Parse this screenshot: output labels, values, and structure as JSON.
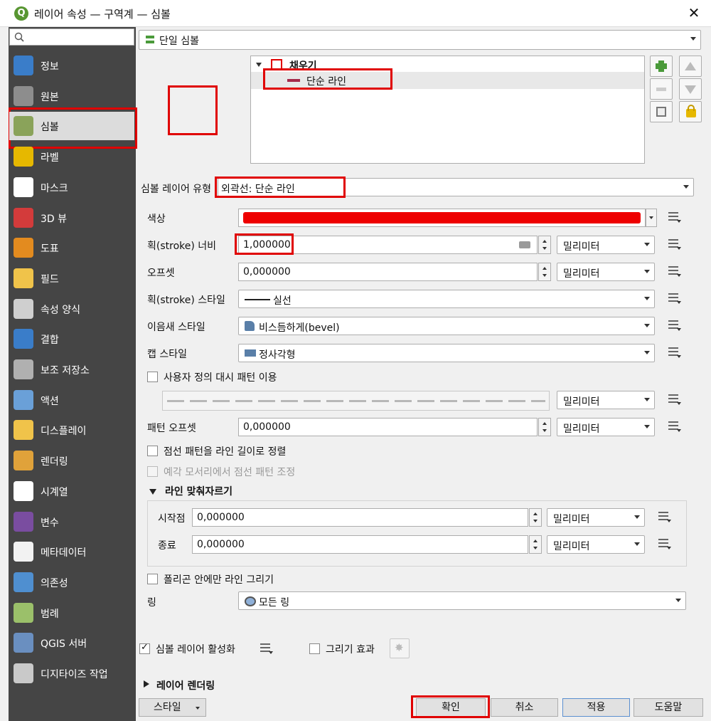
{
  "window": {
    "title": "레이어 속성 — 구역계 — 심볼",
    "app_icon": "Q",
    "close_label": "✕"
  },
  "sidebar": {
    "items": [
      {
        "label": "정보",
        "icon": "info-icon",
        "color": "#3a7dc9"
      },
      {
        "label": "원본",
        "icon": "source-icon",
        "color": "#8d8d8d"
      },
      {
        "label": "심볼",
        "icon": "symbology-icon",
        "color": "#8aa35a"
      },
      {
        "label": "라벨",
        "icon": "labels-icon",
        "color": "#e6b800"
      },
      {
        "label": "마스크",
        "icon": "mask-icon",
        "color": "#ffffff"
      },
      {
        "label": "3D 뷰",
        "icon": "3d-view-icon",
        "color": "#d33b3b"
      },
      {
        "label": "도표",
        "icon": "diagram-icon",
        "color": "#e38b1f"
      },
      {
        "label": "필드",
        "icon": "fields-icon",
        "color": "#f0c34a"
      },
      {
        "label": "속성 양식",
        "icon": "attributes-form-icon",
        "color": "#cfcfcf"
      },
      {
        "label": "결합",
        "icon": "joins-icon",
        "color": "#3a7dc9"
      },
      {
        "label": "보조 저장소",
        "icon": "auxiliary-storage-icon",
        "color": "#b0b0b0"
      },
      {
        "label": "액션",
        "icon": "actions-icon",
        "color": "#6aa0d8"
      },
      {
        "label": "디스플레이",
        "icon": "display-icon",
        "color": "#f0c34a"
      },
      {
        "label": "렌더링",
        "icon": "rendering-icon",
        "color": "#e0a23a"
      },
      {
        "label": "시계열",
        "icon": "temporal-icon",
        "color": "#ffffff"
      },
      {
        "label": "변수",
        "icon": "variables-icon",
        "color": "#7a4da0"
      },
      {
        "label": "메타데이터",
        "icon": "metadata-icon",
        "color": "#f2f2f2"
      },
      {
        "label": "의존성",
        "icon": "dependencies-icon",
        "color": "#4f8fd0"
      },
      {
        "label": "범례",
        "icon": "legend-icon",
        "color": "#9bc06a"
      },
      {
        "label": "QGIS 서버",
        "icon": "qgis-server-icon",
        "color": "#6a8fc0"
      },
      {
        "label": "디지타이즈 작업",
        "icon": "digitizing-icon",
        "color": "#c9c9c9"
      }
    ],
    "selected_index": 2
  },
  "renderer": {
    "label": "단일 심볼"
  },
  "tree": {
    "root": "채우기",
    "child": "단순 라인"
  },
  "symbol_layer_type": {
    "label": "심볼 레이어 유형",
    "value": "외곽선: 단순 라인"
  },
  "props": {
    "color_label": "색상",
    "color_value": "#ee0000",
    "stroke_width_label": "획(stroke) 너비",
    "stroke_width": "1,000000",
    "stroke_width_unit": "밀리미터",
    "offset_label": "오프셋",
    "offset": "0,000000",
    "offset_unit": "밀리미터",
    "stroke_style_label": "획(stroke) 스타일",
    "stroke_style": "실선",
    "join_style_label": "이음새 스타일",
    "join_style": "비스듬하게(bevel)",
    "cap_style_label": "캡 스타일",
    "cap_style": "정사각형",
    "custom_dash_label": "사용자 정의 대시 패턴 이용",
    "custom_dash_unit": "밀리미터",
    "pattern_offset_label": "패턴 오프셋",
    "pattern_offset": "0,000000",
    "pattern_offset_unit": "밀리미터",
    "align_dash_label": "점선 패턴을 라인 길이로 정렬",
    "tweak_dash_label": "예각 모서리에서 점선 패턴 조정"
  },
  "trim": {
    "title": "라인 맞춰자르기",
    "start_label": "시작점",
    "start_value": "0,000000",
    "start_unit": "밀리미터",
    "end_label": "종료",
    "end_value": "0,000000",
    "end_unit": "밀리미터"
  },
  "inside_polygon_label": "폴리곤 안에만 라인 그리기",
  "ring_label": "링",
  "ring_value": "모든 링",
  "enable_layer_label": "심볼 레이어 활성화",
  "draw_effects_label": "그리기 효과",
  "layer_rendering_label": "레이어 렌더링",
  "buttons": {
    "style": "스타일",
    "ok": "확인",
    "cancel": "취소",
    "apply": "적용",
    "help": "도움말"
  }
}
